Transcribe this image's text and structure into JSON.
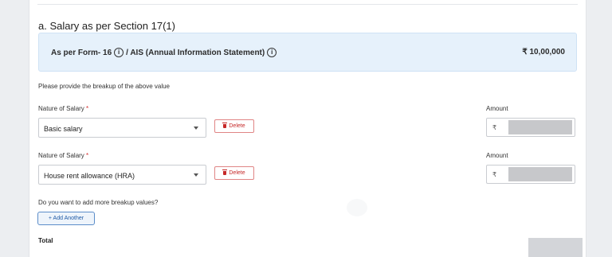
{
  "section": {
    "title": "a. Salary as per Section 17(1)",
    "info_label_part1": "As per Form- 16",
    "info_label_part2": "/ AIS (Annual Information Statement)",
    "info_icon": "i",
    "info_amount": "₹ 10,00,000"
  },
  "helper_text": "Please provide the breakup of the above value",
  "rows": [
    {
      "nature_label": "Nature of Salary",
      "required_mark": "*",
      "selected_value": "Basic salary",
      "delete_label": "Delete",
      "amount_label": "Amount",
      "currency_symbol": "₹"
    },
    {
      "nature_label": "Nature of Salary",
      "required_mark": "*",
      "selected_value": "House rent allowance (HRA)",
      "delete_label": "Delete",
      "amount_label": "Amount",
      "currency_symbol": "₹"
    }
  ],
  "add_more": {
    "question": "Do you want to add more breakup values?",
    "button_label": "+ Add Another"
  },
  "total_label": "Total",
  "colors": {
    "info_bg": "#e6f1fb",
    "delete_red": "#c62828",
    "add_blue": "#1f5aa6"
  }
}
